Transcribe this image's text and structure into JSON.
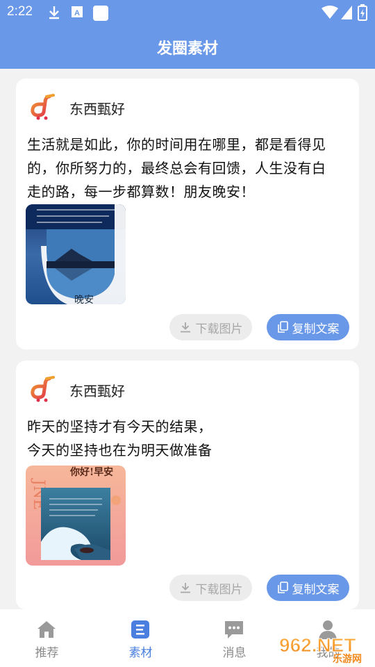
{
  "status_bar": {
    "time": "2:22"
  },
  "header": {
    "title": "发圈素材"
  },
  "posts": [
    {
      "username": "东西甄好",
      "text": "生活就是如此，你的时间用在哪里，都是看得见\n的，你所努力的，最终总会有回馈，人生没有白\n走的路，每一步都算数！朋友晚安！",
      "image_caption": "晚安",
      "download_label": "下载图片",
      "copy_label": "复制文案"
    },
    {
      "username": "东西甄好",
      "text": "昨天的坚持才有今天的结果，\n今天的坚持也在为明天做准备",
      "image_caption": "你好!早安",
      "download_label": "下载图片",
      "copy_label": "复制文案"
    }
  ],
  "tabbar": {
    "tabs": [
      {
        "label": "推荐",
        "icon": "home-icon"
      },
      {
        "label": "素材",
        "icon": "material-icon",
        "active": true
      },
      {
        "label": "消息",
        "icon": "message-icon"
      },
      {
        "label": "我的",
        "icon": "profile-icon"
      }
    ]
  },
  "watermark": {
    "text": "962.NET",
    "subtext": "乐游网"
  },
  "colors": {
    "accent": "#6a98e8",
    "active_tab": "#4a7fe0"
  }
}
